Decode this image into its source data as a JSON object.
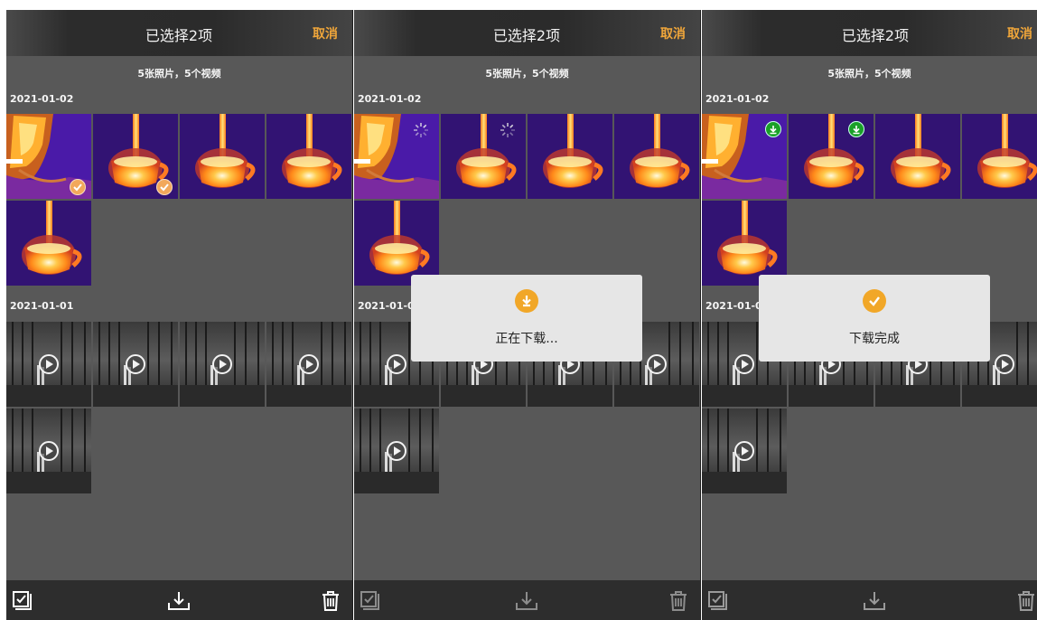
{
  "header": {
    "title": "已选择2项",
    "cancel_label": "取消"
  },
  "summary": "5张照片，5个视频",
  "groups": {
    "recent_date": "2021-01-02",
    "older_date": "2021-01-01"
  },
  "toasts": {
    "downloading": "正在下载...",
    "done": "下载完成"
  },
  "icons": {
    "selected_check": "check-circle-icon",
    "video": "play-circle-icon",
    "loading": "spinner-icon",
    "downloaded": "download-done-icon",
    "toolbar": [
      "select-all-icon",
      "download-icon",
      "trash-icon"
    ]
  },
  "colors": {
    "accent": "#f0a63a",
    "check_fill": "#f2a85b",
    "downloaded_badge": "#1aa028",
    "toast_icon": "#f1a728"
  }
}
